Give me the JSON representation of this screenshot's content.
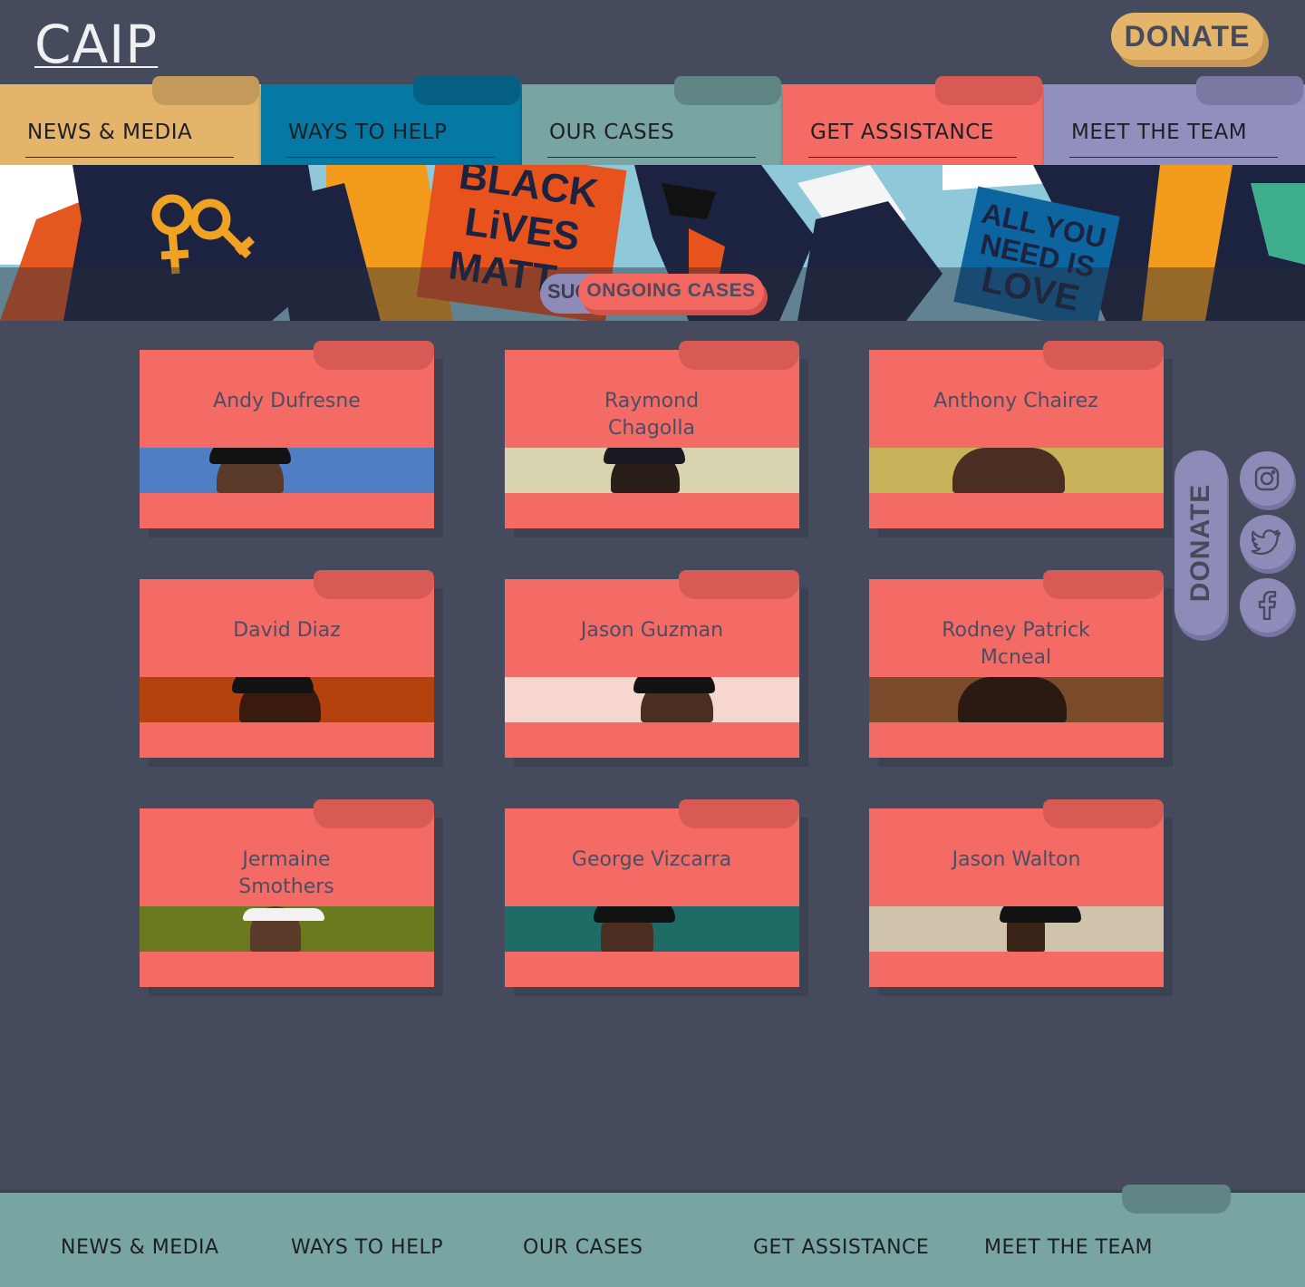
{
  "header": {
    "logo": "CAIP",
    "donate_label": "DONATE"
  },
  "nav": {
    "items": [
      {
        "label": "NEWS & MEDIA",
        "color": "#e3b46a",
        "ear": "#c49a5a"
      },
      {
        "label": "WAYS TO HELP",
        "color": "#0579a3",
        "ear": "#045f82"
      },
      {
        "label": "OUR CASES",
        "color": "#78a4a1",
        "ear": "#5f8584"
      },
      {
        "label": "GET ASSISTANCE",
        "color": "#f36b64",
        "ear": "#d85a54"
      },
      {
        "label": "MEET THE TEAM",
        "color": "#918fbd",
        "ear": "#7b79a3"
      }
    ]
  },
  "hero": {
    "tabs": [
      {
        "label": "SUCCESSFUL CASES"
      },
      {
        "label": "ONGOING CASES",
        "active": true
      }
    ]
  },
  "cases": [
    {
      "name": "Andy Dufresne",
      "photo_bg": "#4f7ec4"
    },
    {
      "name": "Raymond Chagolla",
      "photo_bg": "#d8d4b0"
    },
    {
      "name": "Anthony Chairez",
      "photo_bg": "#c9b35a"
    },
    {
      "name": "David Diaz",
      "photo_bg": "#b4420f"
    },
    {
      "name": "Jason Guzman",
      "photo_bg": "#f7d6d0"
    },
    {
      "name": "Rodney Patrick Mcneal",
      "photo_bg": "#7a4a2a"
    },
    {
      "name": "Jermaine Smothers",
      "photo_bg": "#6b7a1e"
    },
    {
      "name": "George Vizcarra",
      "photo_bg": "#1f6b66"
    },
    {
      "name": "Jason Walton",
      "photo_bg": "#cfc3ac"
    }
  ],
  "side": {
    "donate_label": "DONATE",
    "social": [
      "instagram-icon",
      "twitter-icon",
      "facebook-icon"
    ]
  },
  "footer": {
    "links": [
      "NEWS & MEDIA",
      "WAYS TO HELP",
      "OUR CASES",
      "GET ASSISTANCE",
      "MEET THE TEAM"
    ]
  }
}
